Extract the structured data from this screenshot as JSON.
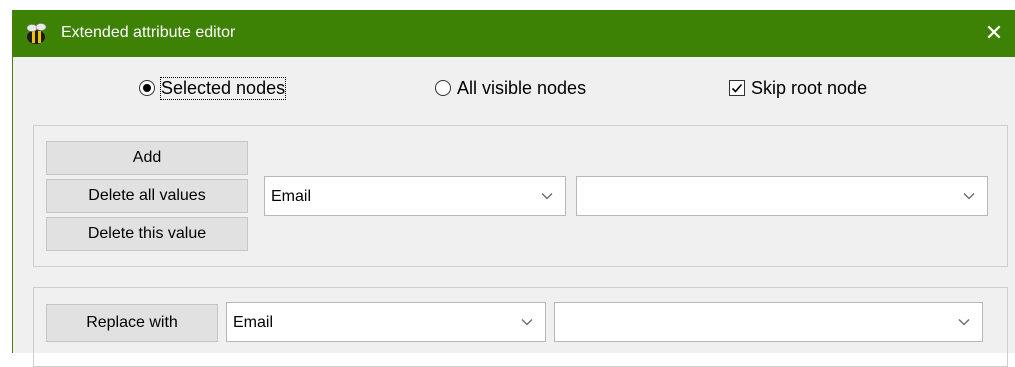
{
  "window": {
    "title": "Extended attribute editor",
    "close_glyph": "✕",
    "accent_color": "#3d8204"
  },
  "scope": {
    "selected_nodes": {
      "label": "Selected nodes",
      "checked": true
    },
    "all_visible_nodes": {
      "label": "All visible nodes",
      "checked": false
    },
    "skip_root_node": {
      "label": "Skip root node",
      "checked": true
    }
  },
  "edit_group": {
    "add_label": "Add",
    "delete_all_label": "Delete all values",
    "delete_this_label": "Delete this value",
    "attribute_value": "Email",
    "value_value": ""
  },
  "replace_group": {
    "replace_label": "Replace with",
    "attribute_value": "Email",
    "value_value": ""
  },
  "icons": {
    "app": "bee-icon",
    "close": "close-icon",
    "dropdown": "chevron-down-icon"
  }
}
